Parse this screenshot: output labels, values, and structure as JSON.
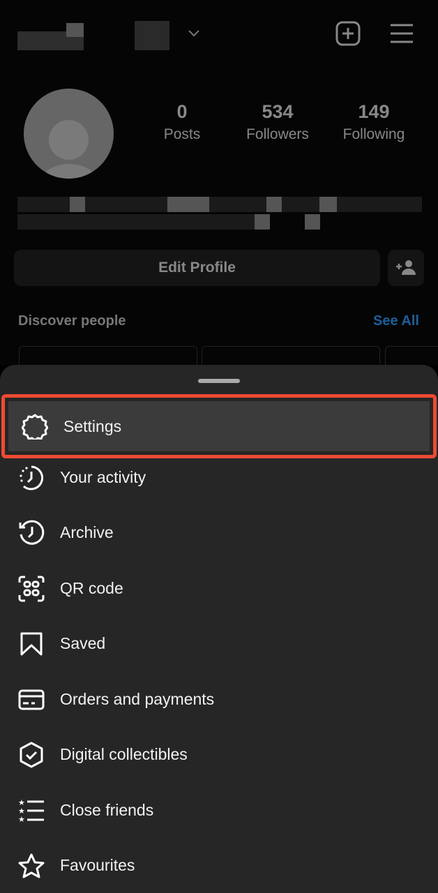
{
  "header": {
    "account_switcher_icon": "chevron-down-icon",
    "new_post_icon": "plus-square-icon",
    "menu_icon": "hamburger-icon"
  },
  "profile": {
    "stats": [
      {
        "value": "0",
        "label": "Posts"
      },
      {
        "value": "534",
        "label": "Followers"
      },
      {
        "value": "149",
        "label": "Following"
      }
    ],
    "edit_profile_label": "Edit Profile",
    "discover_label": "Discover people",
    "see_all_label": "See All",
    "see_all_color": "#1d5f9a"
  },
  "menu": {
    "highlight_color": "#f04a32",
    "items": [
      {
        "label": "Settings",
        "icon": "gear-icon"
      },
      {
        "label": "Your activity",
        "icon": "activity-clock-icon"
      },
      {
        "label": "Archive",
        "icon": "archive-history-icon"
      },
      {
        "label": "QR code",
        "icon": "qr-code-icon"
      },
      {
        "label": "Saved",
        "icon": "bookmark-icon"
      },
      {
        "label": "Orders and payments",
        "icon": "credit-card-icon"
      },
      {
        "label": "Digital collectibles",
        "icon": "hexagon-check-icon"
      },
      {
        "label": "Close friends",
        "icon": "star-list-icon"
      },
      {
        "label": "Favourites",
        "icon": "star-icon"
      }
    ]
  }
}
